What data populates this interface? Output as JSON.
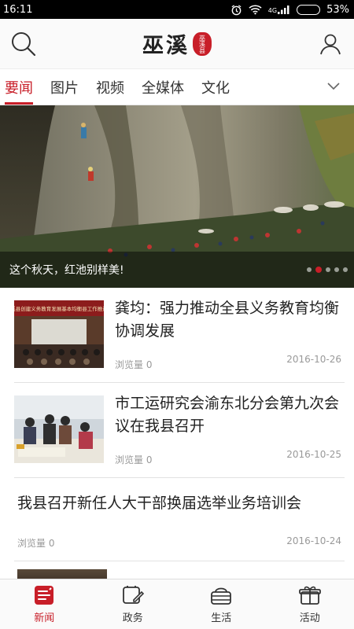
{
  "status_bar": {
    "time": "16:11",
    "network": "4G",
    "battery": "53%",
    "battery_level": 0.53,
    "icons": [
      "alarm-icon",
      "wifi-icon",
      "signal-icon",
      "battery-icon"
    ]
  },
  "header": {
    "logo_text": "巫溪",
    "logo_seal": "巫溪县",
    "left_icon": "search-icon",
    "right_icon": "user-icon"
  },
  "tabs": [
    {
      "label": "要闻",
      "active": true
    },
    {
      "label": "图片",
      "active": false
    },
    {
      "label": "视频",
      "active": false
    },
    {
      "label": "全媒体",
      "active": false
    },
    {
      "label": "文化",
      "active": false
    }
  ],
  "tabs_more_icon": "chevron-down-icon",
  "banner": {
    "caption": "这个秋天，红池别样美!",
    "slide_count": 5,
    "active_slide": 2
  },
  "news": [
    {
      "title": "龚均：强力推动全县义务教育均衡协调发展",
      "views": "浏览量 0",
      "date": "2016-10-26",
      "has_thumb": true,
      "thumb_banner_text": "巫溪县创建义务教育发展基本均衡县工作推进会"
    },
    {
      "title": "市工运研究会渝东北分会第九次会议在我县召开",
      "views": "浏览量 0",
      "date": "2016-10-25",
      "has_thumb": true
    },
    {
      "title": "我县召开新任人大干部换届选举业务培训会",
      "views": "浏览量 0",
      "date": "2016-10-24",
      "has_thumb": false
    }
  ],
  "bottom_nav": [
    {
      "label": "新闻",
      "icon": "news-icon",
      "active": true
    },
    {
      "label": "政务",
      "icon": "government-icon",
      "active": false
    },
    {
      "label": "生活",
      "icon": "basket-icon",
      "active": false
    },
    {
      "label": "活动",
      "icon": "gift-icon",
      "active": false
    }
  ],
  "colors": {
    "accent": "#c81e28",
    "text": "#222222",
    "muted": "#999999",
    "status_bar": "#000000"
  }
}
